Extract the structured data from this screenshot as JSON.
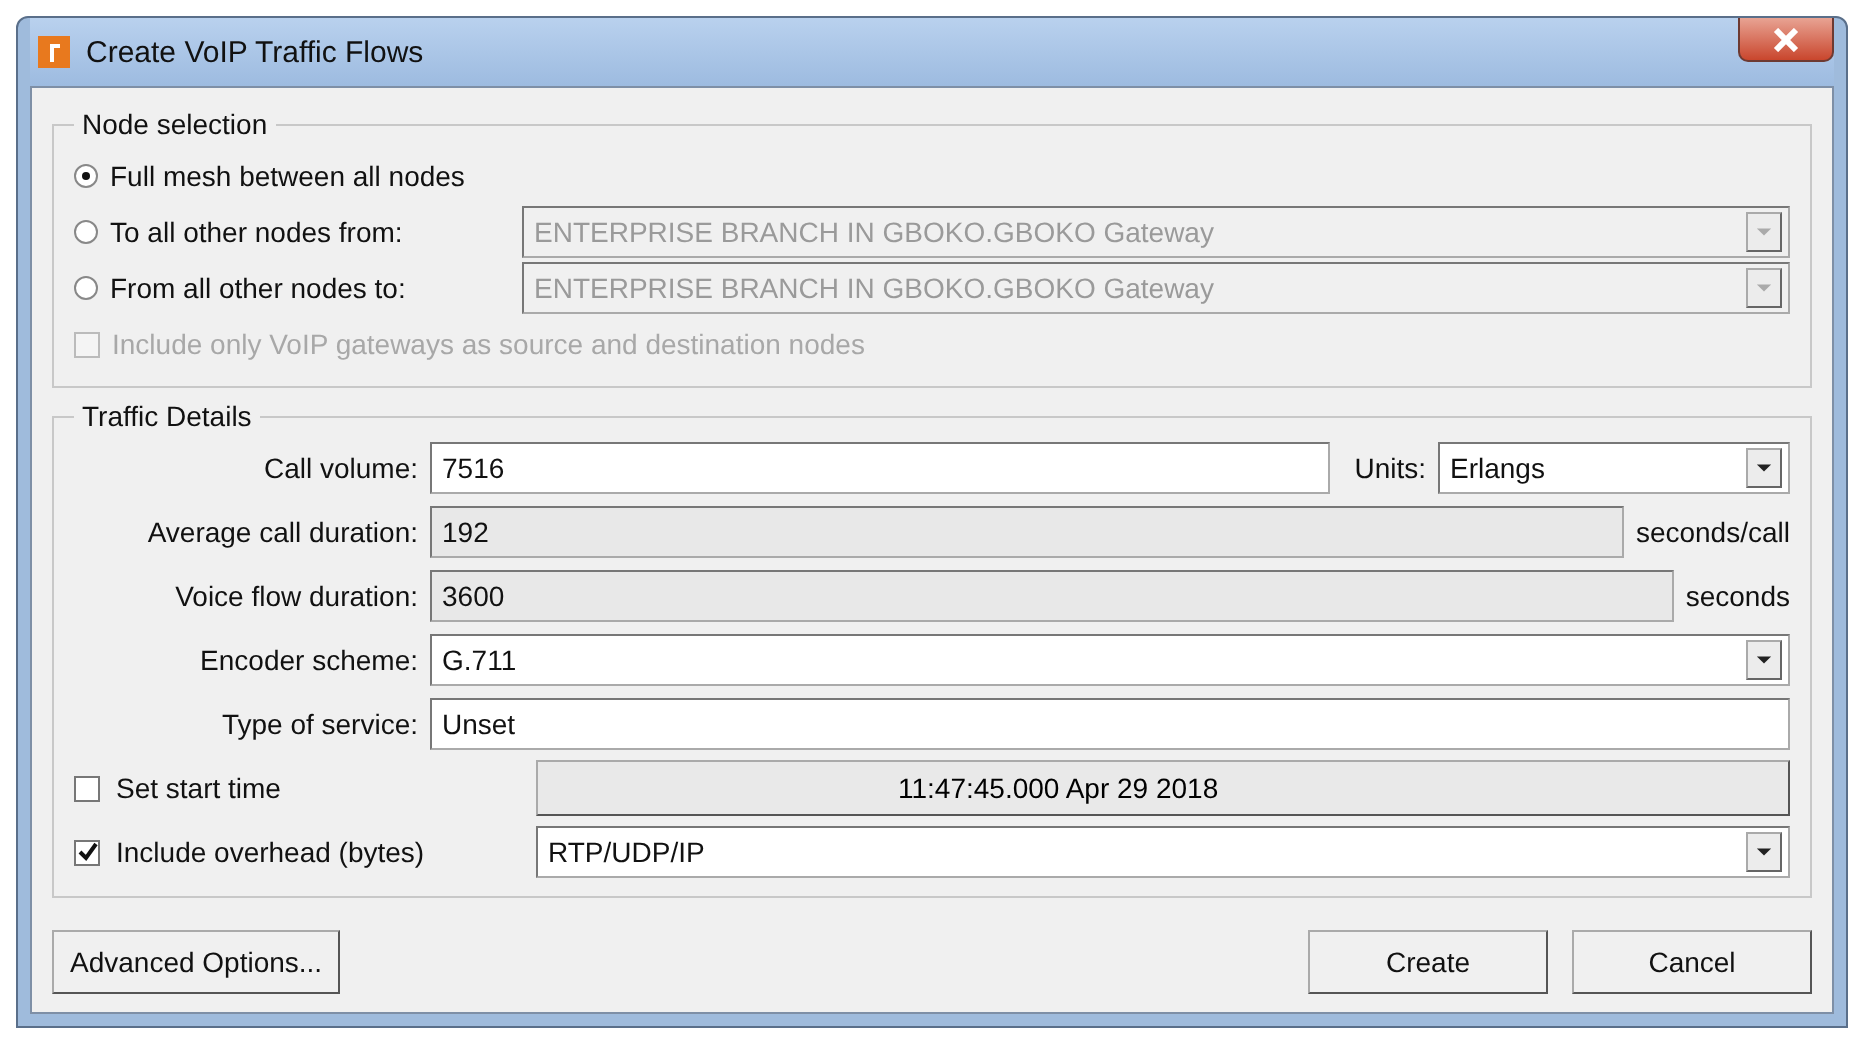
{
  "window": {
    "title": "Create VoIP Traffic Flows"
  },
  "node_selection": {
    "title": "Node selection",
    "options": [
      {
        "label": "Full mesh between all nodes",
        "selected": true
      },
      {
        "label": "To all other nodes from:",
        "selected": false,
        "disabled": true,
        "value": "ENTERPRISE BRANCH IN GBOKO.GBOKO Gateway"
      },
      {
        "label": "From all other nodes to:",
        "selected": false,
        "disabled": true,
        "value": "ENTERPRISE BRANCH IN GBOKO.GBOKO Gateway"
      }
    ],
    "gateways_only": {
      "label": "Include only VoIP gateways as source and destination nodes",
      "checked": false,
      "disabled": true
    }
  },
  "traffic_details": {
    "title": "Traffic Details",
    "rows": [
      {
        "kind": "field",
        "label": "Call volume:",
        "value": "7516",
        "disabled": false,
        "units": {
          "label": "Units:",
          "value": "Erlangs"
        }
      },
      {
        "kind": "field",
        "label": "Average call duration:",
        "value": "192",
        "disabled": true,
        "unit": "seconds/call"
      },
      {
        "kind": "field",
        "label": "Voice flow duration:",
        "value": "3600",
        "disabled": true,
        "unit": "seconds"
      },
      {
        "kind": "dropdown",
        "label": "Encoder scheme:",
        "value": "G.711"
      },
      {
        "kind": "field",
        "label": "Type of service:",
        "value": "Unset",
        "disabled": false
      },
      {
        "kind": "check_button",
        "label": "Set start time",
        "checked": false,
        "value": "11:47:45.000 Apr 29 2018"
      },
      {
        "kind": "check_dropdown",
        "label": "Include overhead (bytes)",
        "checked": true,
        "value": "RTP/UDP/IP"
      }
    ]
  },
  "buttons": {
    "left": [
      "Advanced Options..."
    ],
    "right": [
      "Create",
      "Cancel"
    ]
  }
}
